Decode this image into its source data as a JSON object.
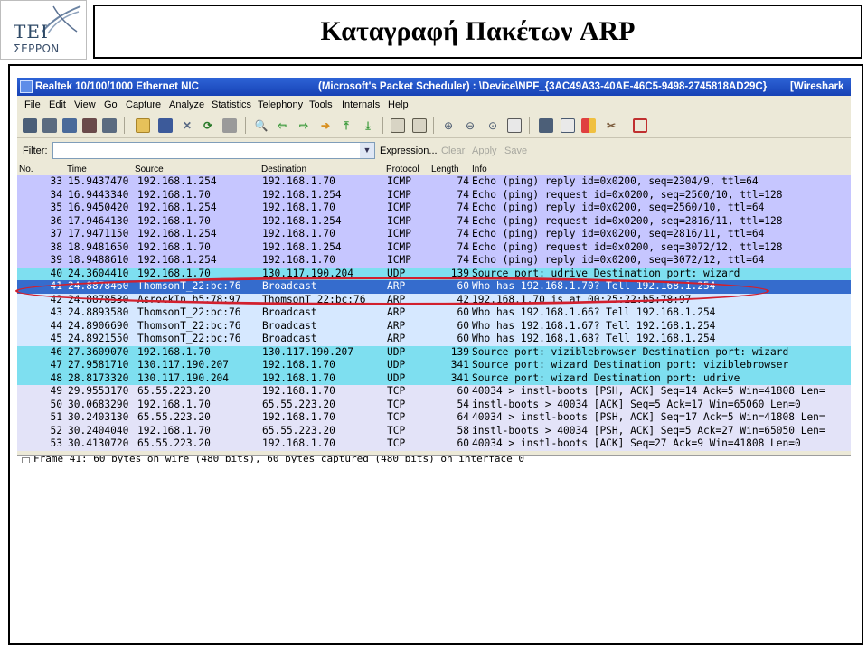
{
  "logo": {
    "line1": "ΤΕΙ",
    "line2": "ΣΕΡΡΩΝ"
  },
  "slide_title": "Καταγραφή Πακέτων ARP",
  "window": {
    "title": "Realtek 10/100/1000 Ethernet NIC",
    "scheduler": "(Microsoft's Packet Scheduler) : \\Device\\NPF_{3AC49A33-40AE-46C5-9498-2745818AD29C}",
    "app": "[Wireshark"
  },
  "menu": [
    "File",
    "Edit",
    "View",
    "Go",
    "Capture",
    "Analyze",
    "Statistics",
    "Telephony",
    "Tools",
    "Internals",
    "Help"
  ],
  "toolbar_icons": [
    "interfaces-icon",
    "options-icon",
    "start-icon",
    "stop-icon",
    "restart-icon",
    "open-icon",
    "save-icon",
    "close-icon",
    "reload-icon",
    "print-icon",
    "find-icon",
    "back-icon",
    "forward-icon",
    "goto-icon",
    "first-icon",
    "last-icon",
    "colorize-icon",
    "autoscroll-icon",
    "zoom-in-icon",
    "zoom-out-icon",
    "normal-size-icon",
    "resize-columns-icon",
    "capture-filters-icon",
    "display-filters-icon",
    "coloring-rules-icon",
    "preferences-icon",
    "help-icon"
  ],
  "filter": {
    "label": "Filter:",
    "value": "",
    "expression": "Expression...",
    "clear": "Clear",
    "apply": "Apply",
    "save": "Save"
  },
  "columns": [
    "No.",
    "Time",
    "Source",
    "Destination",
    "Protocol",
    "Length",
    "Info"
  ],
  "colors": {
    "icmp": "#c6c6ff",
    "udp": "#7edff0",
    "arp": "#d6e8ff",
    "tcp": "#e3e3f8",
    "selected": "#356ccd",
    "highlight": "#d2202e"
  },
  "packets": [
    {
      "no": "33",
      "time": "15.9437470",
      "src": "192.168.1.254",
      "dst": "192.168.1.70",
      "proto": "ICMP",
      "len": "74",
      "info": "Echo (ping) reply    id=0x0200, seq=2304/9, ttl=64",
      "kind": "icmp"
    },
    {
      "no": "34",
      "time": "16.9443340",
      "src": "192.168.1.70",
      "dst": "192.168.1.254",
      "proto": "ICMP",
      "len": "74",
      "info": "Echo (ping) request  id=0x0200, seq=2560/10, ttl=128",
      "kind": "icmp"
    },
    {
      "no": "35",
      "time": "16.9450420",
      "src": "192.168.1.254",
      "dst": "192.168.1.70",
      "proto": "ICMP",
      "len": "74",
      "info": "Echo (ping) reply    id=0x0200, seq=2560/10, ttl=64",
      "kind": "icmp"
    },
    {
      "no": "36",
      "time": "17.9464130",
      "src": "192.168.1.70",
      "dst": "192.168.1.254",
      "proto": "ICMP",
      "len": "74",
      "info": "Echo (ping) request  id=0x0200, seq=2816/11, ttl=128",
      "kind": "icmp"
    },
    {
      "no": "37",
      "time": "17.9471150",
      "src": "192.168.1.254",
      "dst": "192.168.1.70",
      "proto": "ICMP",
      "len": "74",
      "info": "Echo (ping) reply    id=0x0200, seq=2816/11, ttl=64",
      "kind": "icmp"
    },
    {
      "no": "38",
      "time": "18.9481650",
      "src": "192.168.1.70",
      "dst": "192.168.1.254",
      "proto": "ICMP",
      "len": "74",
      "info": "Echo (ping) request  id=0x0200, seq=3072/12, ttl=128",
      "kind": "icmp"
    },
    {
      "no": "39",
      "time": "18.9488610",
      "src": "192.168.1.254",
      "dst": "192.168.1.70",
      "proto": "ICMP",
      "len": "74",
      "info": "Echo (ping) reply    id=0x0200, seq=3072/12, ttl=64",
      "kind": "icmp"
    },
    {
      "no": "40",
      "time": "24.3604410",
      "src": "192.168.1.70",
      "dst": "130.117.190.204",
      "proto": "UDP",
      "len": "139",
      "info": "Source port: udrive  Destination port: wizard",
      "kind": "udp"
    },
    {
      "no": "41",
      "time": "24.8878460",
      "src": "ThomsonT_22:bc:76",
      "dst": "Broadcast",
      "proto": "ARP",
      "len": "60",
      "info": "Who has 192.168.1.70?  Tell 192.168.1.254",
      "kind": "selected"
    },
    {
      "no": "42",
      "time": "24.8878530",
      "src": "AsrockIn_b5:78:97",
      "dst": "ThomsonT_22:bc:76",
      "proto": "ARP",
      "len": "42",
      "info": "192.168.1.70 is at 00:25:22:b5:78:97",
      "kind": "arp"
    },
    {
      "no": "43",
      "time": "24.8893580",
      "src": "ThomsonT_22:bc:76",
      "dst": "Broadcast",
      "proto": "ARP",
      "len": "60",
      "info": "Who has 192.168.1.66?  Tell 192.168.1.254",
      "kind": "arp"
    },
    {
      "no": "44",
      "time": "24.8906690",
      "src": "ThomsonT_22:bc:76",
      "dst": "Broadcast",
      "proto": "ARP",
      "len": "60",
      "info": "Who has 192.168.1.67?  Tell 192.168.1.254",
      "kind": "arp"
    },
    {
      "no": "45",
      "time": "24.8921550",
      "src": "ThomsonT_22:bc:76",
      "dst": "Broadcast",
      "proto": "ARP",
      "len": "60",
      "info": "Who has 192.168.1.68?  Tell 192.168.1.254",
      "kind": "arp"
    },
    {
      "no": "46",
      "time": "27.3609070",
      "src": "192.168.1.70",
      "dst": "130.117.190.207",
      "proto": "UDP",
      "len": "139",
      "info": "Source port: viziblebrowser  Destination port: wizard",
      "kind": "udp"
    },
    {
      "no": "47",
      "time": "27.9581710",
      "src": "130.117.190.207",
      "dst": "192.168.1.70",
      "proto": "UDP",
      "len": "341",
      "info": "Source port: wizard  Destination port: viziblebrowser",
      "kind": "udp"
    },
    {
      "no": "48",
      "time": "28.8173320",
      "src": "130.117.190.204",
      "dst": "192.168.1.70",
      "proto": "UDP",
      "len": "341",
      "info": "Source port: wizard  Destination port: udrive",
      "kind": "udp"
    },
    {
      "no": "49",
      "time": "29.9553170",
      "src": "65.55.223.20",
      "dst": "192.168.1.70",
      "proto": "TCP",
      "len": "60",
      "info": "40034 > instl-boots [PSH, ACK] Seq=14 Ack=5 Win=41808 Len=",
      "kind": "tcp"
    },
    {
      "no": "50",
      "time": "30.0683290",
      "src": "192.168.1.70",
      "dst": "65.55.223.20",
      "proto": "TCP",
      "len": "54",
      "info": "instl-boots > 40034 [ACK] Seq=5 Ack=17 Win=65060 Len=0",
      "kind": "tcp"
    },
    {
      "no": "51",
      "time": "30.2403130",
      "src": "65.55.223.20",
      "dst": "192.168.1.70",
      "proto": "TCP",
      "len": "64",
      "info": "40034 > instl-boots [PSH, ACK] Seq=17 Ack=5 Win=41808 Len=",
      "kind": "tcp"
    },
    {
      "no": "52",
      "time": "30.2404040",
      "src": "192.168.1.70",
      "dst": "65.55.223.20",
      "proto": "TCP",
      "len": "58",
      "info": "instl-boots > 40034 [PSH, ACK] Seq=5 Ack=27 Win=65050 Len=",
      "kind": "tcp"
    },
    {
      "no": "53",
      "time": "30.4130720",
      "src": "65.55.223.20",
      "dst": "192.168.1.70",
      "proto": "TCP",
      "len": "60",
      "info": "40034 > instl-boots [ACK] Seq=27 Ack=9 Win=41808 Len=0",
      "kind": "tcp"
    }
  ],
  "detail": "Frame 41: 60 bytes on wire (480 bits), 60 bytes captured (480 bits) on interface 0"
}
